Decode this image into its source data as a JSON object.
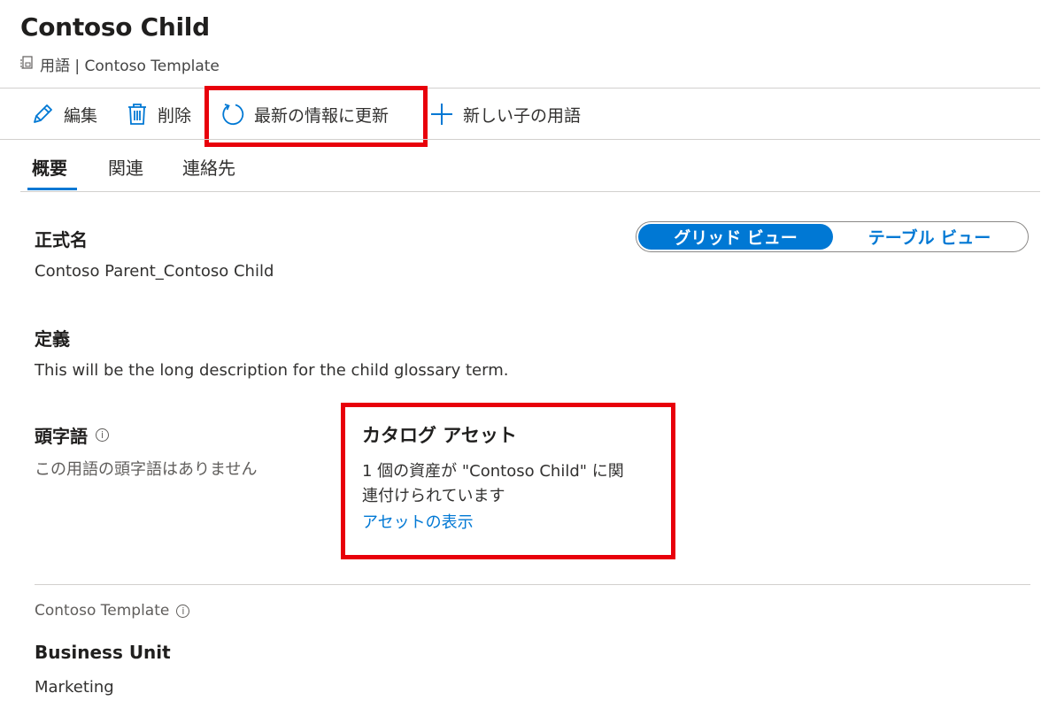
{
  "header": {
    "title": "Contoso Child",
    "subtitle": "用語 | Contoso Template"
  },
  "toolbar": {
    "edit_label": "編集",
    "delete_label": "削除",
    "refresh_label": "最新の情報に更新",
    "new_child_label": "新しい子の用語"
  },
  "tabs": [
    {
      "label": "概要",
      "active": true
    },
    {
      "label": "関連",
      "active": false
    },
    {
      "label": "連絡先",
      "active": false
    }
  ],
  "view_toggle": {
    "grid_label": "グリッド ビュー",
    "table_label": "テーブル ビュー",
    "selected": "grid"
  },
  "formal_name": {
    "label": "正式名",
    "value": "Contoso Parent_Contoso Child"
  },
  "definition": {
    "label": "定義",
    "value": "This will be the long description for the child glossary term."
  },
  "acronym": {
    "label": "頭字語",
    "value": "この用語の頭字語はありません"
  },
  "catalog_assets": {
    "label": "カタログ アセット",
    "line1": "1 個の資産が \"Contoso Child\" に関",
    "line2": "連付けられています",
    "link": "アセットの表示"
  },
  "template_section": {
    "label": "Contoso Template",
    "field_label": "Business Unit",
    "field_value": "Marketing"
  },
  "colors": {
    "accent": "#0078d4",
    "highlight": "#e8000b"
  }
}
